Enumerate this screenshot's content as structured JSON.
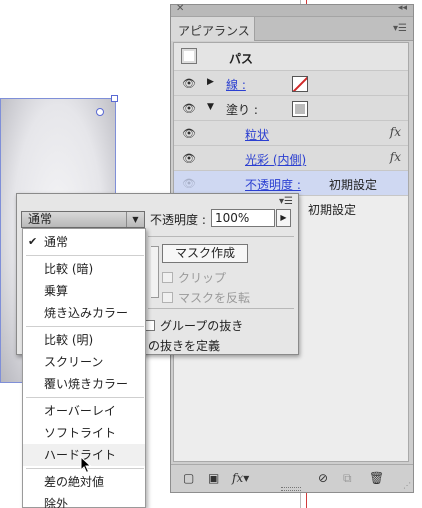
{
  "panel": {
    "tab_label": "アピアランス",
    "path_label": "パス",
    "rows": {
      "stroke_label": "線 :",
      "fill_label": "塗り :",
      "grain_label": "粒状",
      "inner_glow_label": "光彩 (内側)",
      "opacity_label": "不透明度 :",
      "opacity_value": "初期設定",
      "opacity2_value": "初期設定"
    },
    "fx_label": "fx"
  },
  "transparency": {
    "blend_mode": "通常",
    "opacity_label": "不透明度 :",
    "opacity_value": "100%",
    "make_mask": "マスク作成",
    "clip": "クリップ",
    "invert_mask": "マスクを反転",
    "knockout_group": "グループの抜き",
    "define_knockout": "の抜きを定義"
  },
  "blend_menu": {
    "items": [
      "通常",
      "比較 (暗)",
      "乗算",
      "焼き込みカラー",
      "比較 (明)",
      "スクリーン",
      "覆い焼きカラー",
      "オーバーレイ",
      "ソフトライト",
      "ハードライト",
      "差の絶対値",
      "除外"
    ],
    "checked": "通常",
    "hovered": "ハードライト"
  },
  "colors": {
    "selection": "#cfd8f2",
    "link": "#2b3fd1",
    "guide": "#d13b3b"
  }
}
